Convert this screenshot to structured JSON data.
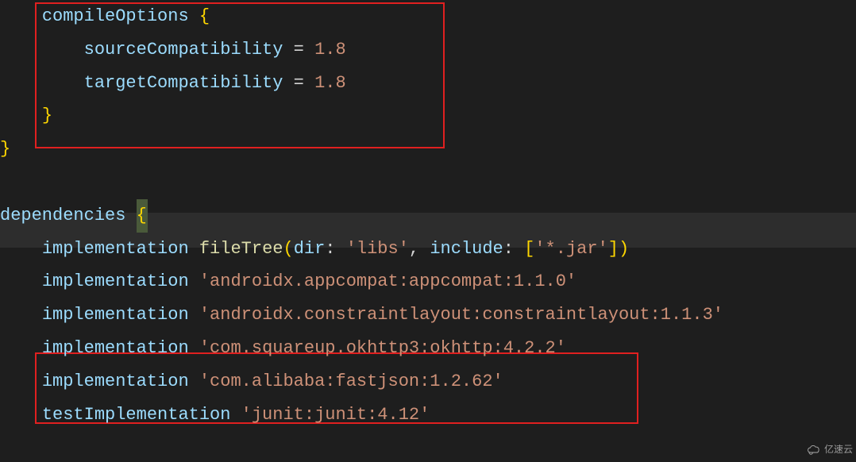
{
  "block1": {
    "compileOptions": "compileOptions",
    "openBrace": "{",
    "sourceCompat": "sourceCompatibility",
    "eq": "=",
    "ver1": "1.8",
    "targetCompat": "targetCompatibility",
    "ver2": "1.8",
    "closeBrace": "}",
    "outerClose": "}"
  },
  "block2": {
    "dependencies": "dependencies",
    "openBrace": "{",
    "impl1": "implementation",
    "fileTree": "fileTree",
    "paren1": "(",
    "dir": "dir",
    "colon": ":",
    "libs": "'libs'",
    "comma": ",",
    "include": "include",
    "jarGlob": "'*.jar'",
    "lbracket": "[",
    "rbracket": "]",
    "paren2": ")",
    "impl2": "implementation",
    "str2": "'androidx.appcompat:appcompat:1.1.0'",
    "impl3": "implementation",
    "str3": "'androidx.constraintlayout:constraintlayout:1.1.3'",
    "impl4": "implementation",
    "str4": "'com.squareup.okhttp3:okhttp:4.2.2'",
    "impl5": "implementation",
    "str5": "'com.alibaba:fastjson:1.2.62'",
    "testImpl": "testImplementation",
    "junit": "'junit:junit:4.12'"
  },
  "watermark": {
    "text": "亿速云"
  }
}
